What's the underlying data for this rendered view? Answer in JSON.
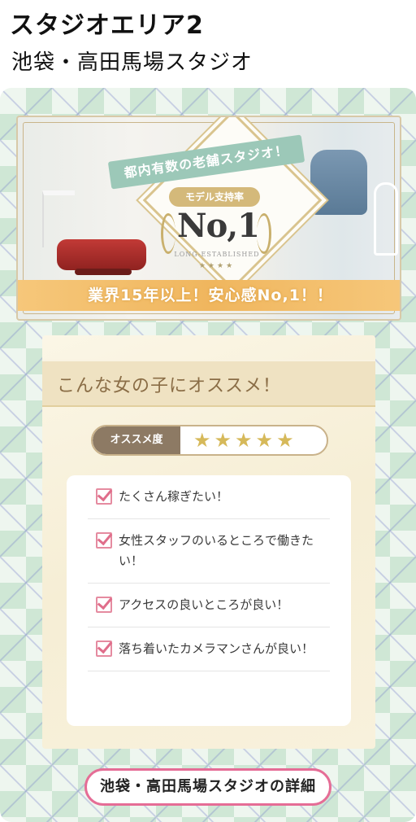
{
  "header": {
    "area_title": "スタジオエリア2",
    "area_subtitle": "池袋・高田馬場スタジオ"
  },
  "banner": {
    "ribbon_text": "都内有数の老舗スタジオ！",
    "model_label": "モデル支持率",
    "rank_text": "No,1",
    "long_established": "LONG-ESTABLISHED",
    "small_stars": "★★★★",
    "strip_text": "業界15年以上！安心感No,1！！"
  },
  "recommend": {
    "title": "こんな女の子にオススメ！",
    "rating_label": "オススメ度",
    "rating_stars": "★★★★★",
    "rating_value": 5,
    "items": [
      "たくさん稼ぎたい！",
      "女性スタッフのいるところで働きたい！",
      "アクセスの良いところが良い！",
      "落ち着いたカメラマンさんが良い！"
    ]
  },
  "detail_button": {
    "label": "池袋・高田馬場スタジオの詳細"
  },
  "colors": {
    "accent_pink": "#e56d96",
    "argyle_green": "#cfe7d5",
    "panel_beige": "#f6eed5",
    "strip_orange": "#f0b65e"
  }
}
